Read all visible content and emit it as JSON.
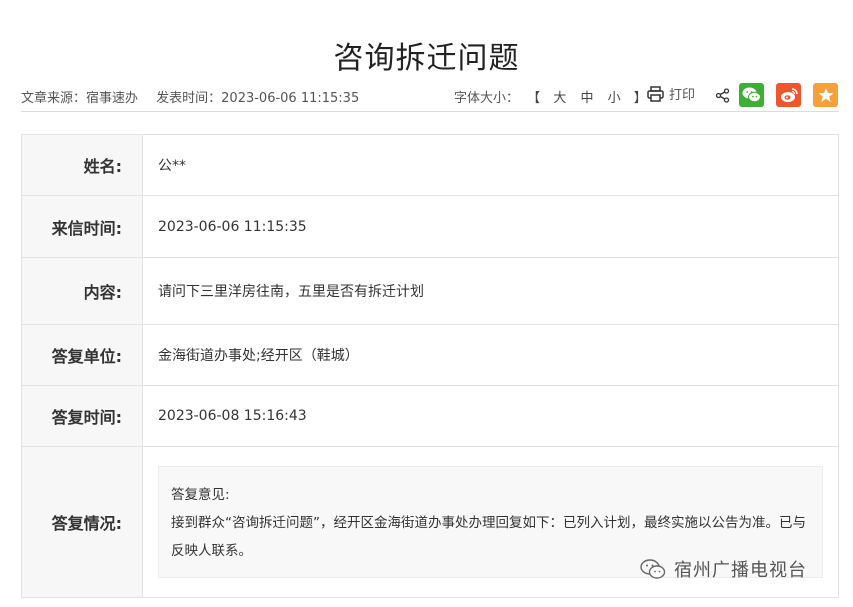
{
  "article": {
    "title": "咨询拆迁问题",
    "source": "文章来源：宿事速办",
    "publish_time": "发表时间：2023-06-06 11:15:35"
  },
  "toolbar": {
    "font_size_label": "字体大小：",
    "bracket_open": "【",
    "bracket_close": "】",
    "font_large": "大",
    "font_medium": "中",
    "font_small": "小",
    "print_label": "打印"
  },
  "details": {
    "name_label": "姓名:",
    "name_value": "公**",
    "letter_time_label": "来信时间:",
    "letter_time_value": "2023-06-06 11:15:35",
    "content_label": "内容:",
    "content_value": "请问下三里洋房往南，五里是否有拆迁计划",
    "reply_unit_label": "答复单位:",
    "reply_unit_value": "金海街道办事处;经开区（鞋城）",
    "reply_time_label": "答复时间:",
    "reply_time_value": "2023-06-08 15:16:43",
    "reply_status_label": "答复情况:",
    "reply_opinion_heading": "答复意见:",
    "reply_opinion_text": "接到群众“咨询拆迁问题”，经开区金海街道办事处办理回复如下：已列入计划，最终实施以公告为准。已与反映人联系。"
  },
  "watermark": {
    "text": "宿州广播电视台"
  },
  "colors": {
    "wechat": "#3cb034",
    "weibo": "#f0552d",
    "favorite": "#f4a13a"
  }
}
